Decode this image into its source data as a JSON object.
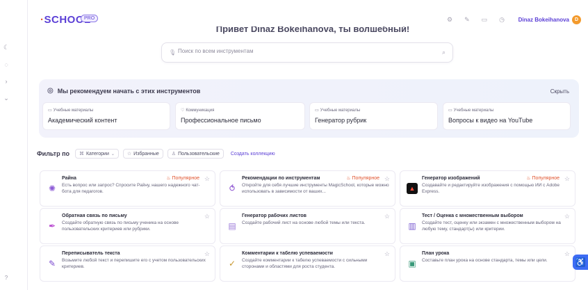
{
  "header": {
    "logo_prefix": "·",
    "logo_text": "SCHOOL",
    "badge": "PRO",
    "user_name": "Dinaz Bokeihanova",
    "avatar_initial": "D",
    "icons": [
      "settings-icon",
      "translate-icon",
      "chat-icon",
      "clock-icon"
    ]
  },
  "greeting": "Привет Dinaz Bokeihanova, ты волшебный!",
  "search": {
    "placeholder": "Поиск по всем инструментам"
  },
  "recommend": {
    "heading": "Мы рекомендуем начать с этих инструментов",
    "hide_label": "Скрыть",
    "cards": [
      {
        "tag": "Учебные материалы",
        "title": "Академический контент"
      },
      {
        "tag": "Коммуникация",
        "title": "Профессиональное письмо"
      },
      {
        "tag": "Учебные материалы",
        "title": "Генератор рубрик"
      },
      {
        "tag": "Учебные материалы",
        "title": "Вопросы к видео на YouTube"
      }
    ]
  },
  "filters": {
    "label": "Фильтр по",
    "categories": "Категории",
    "favorites": "Избранные",
    "custom": "Пользовательские",
    "create_collection": "Создать коллекцию"
  },
  "popular_label": "Популярное",
  "tools": [
    {
      "name": "Райна",
      "desc": "Есть вопрос или запрос? Спросите Райну, нашего надежного чат-бота для педагогов.",
      "popular": true,
      "icon": "raina-robot-icon",
      "color": "#8d5bd6"
    },
    {
      "name": "Рекомендации по инструментам",
      "desc": "Откройте для себя лучшие инструменты MagicSchool, которые можно использовать в зависимости от ваших...",
      "popular": true,
      "icon": "recommend-icon",
      "color": "#8a4fd0"
    },
    {
      "name": "Генератор изображений",
      "desc": "Создавайте и редактируйте изображения с помощью ИИ с Adobe Express.",
      "popular": true,
      "icon": "adobe-express-icon",
      "color": "#1a1a1a"
    },
    {
      "name": "Обратная связь по письму",
      "desc": "Создайте обратную связь по письму ученика на основе пользовательских критериев или рубрики.",
      "popular": false,
      "icon": "pen-feather-icon",
      "color": "#b94ad0"
    },
    {
      "name": "Генератор рабочих листов",
      "desc": "Создайте рабочий лист на основе любой темы или текста.",
      "popular": false,
      "icon": "worksheet-icon",
      "color": "#9b7ad8"
    },
    {
      "name": "Тест / Оценка с множественным выбором",
      "desc": "Создайте тест, оценку или экзамен с множественным выбором на любую тему, стандарт(ы) или критерии.",
      "popular": false,
      "icon": "quiz-icon",
      "color": "#7a5bd0"
    },
    {
      "name": "Переписыватель текста",
      "desc": "Возьмите любой текст и перепишите его с учетом пользовательских критериев.",
      "popular": false,
      "icon": "rewrite-icon",
      "color": "#7b4ad0"
    },
    {
      "name": "Комментарии к табелю успеваемости",
      "desc": "Создайте комментарии к табелю успеваемости с сильными сторонами и областями для роста студента.",
      "popular": false,
      "icon": "medal-icon",
      "color": "#c7962c"
    },
    {
      "name": "План урока",
      "desc": "Составьте план урока на основе стандарта, темы или цели.",
      "popular": false,
      "icon": "lesson-plan-icon",
      "color": "#3a9a7a"
    }
  ]
}
